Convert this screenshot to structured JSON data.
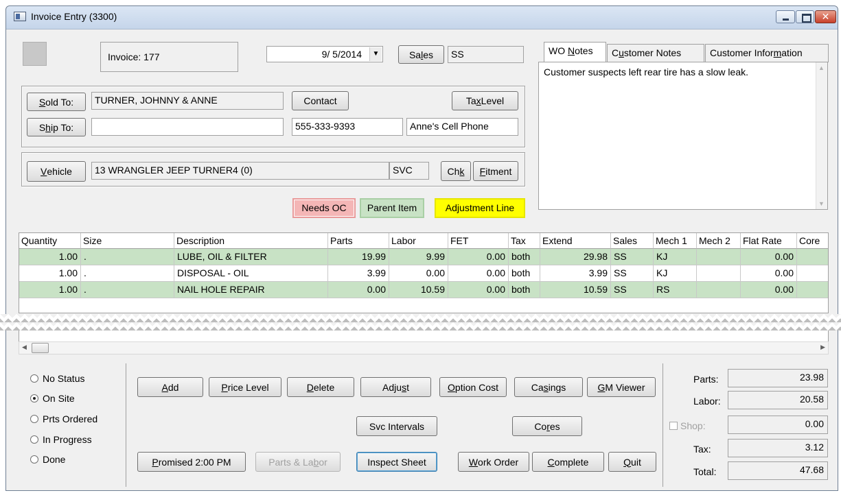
{
  "window": {
    "title": "Invoice Entry (3300)"
  },
  "header": {
    "invoice_label": "Invoice: 177",
    "date_value": "9/ 5/2014",
    "sales_button": "Sales",
    "sales_value": "SS"
  },
  "customer": {
    "sold_to_button": "Sold To:",
    "sold_to_value": "TURNER, JOHNNY & ANNE",
    "ship_to_button": "Ship To:",
    "ship_to_value": "",
    "contact_button": "Contact",
    "tax_level_button": "Tax Level",
    "phone_value": "555-333-9393",
    "phone_desc": "Anne's Cell Phone"
  },
  "vehicle": {
    "vehicle_button": "Vehicle",
    "vehicle_value": "13 WRANGLER JEEP TURNER4 (0)",
    "svc_value": "SVC",
    "chk_button": "Chk",
    "fitment_button": "Fitment"
  },
  "legend": {
    "needs_oc": "Needs OC",
    "parent_item": "Parent Item",
    "adjustment_line": "Adjustment Line",
    "colors": {
      "needs_oc": "#f4b6b6",
      "parent_item": "#c8e2c5",
      "adjustment_line": "#ffff00"
    }
  },
  "notes_tabs": {
    "tabs": [
      "WO Notes",
      "Customer Notes",
      "Customer Information"
    ],
    "active": "WO Notes",
    "text": "Customer suspects left rear tire has a slow leak."
  },
  "grid": {
    "columns": [
      "Quantity",
      "Size",
      "Description",
      "Parts",
      "Labor",
      "FET",
      "Tax",
      "Extend",
      "Sales",
      "Mech 1",
      "Mech 2",
      "Flat Rate",
      "Core"
    ],
    "rows": [
      {
        "quantity": "1.00",
        "size": ".",
        "description": "LUBE, OIL & FILTER",
        "parts": "19.99",
        "labor": "9.99",
        "fet": "0.00",
        "tax": "both",
        "extend": "29.98",
        "sales": "SS",
        "mech1": "KJ",
        "mech2": "",
        "flat_rate": "0.00",
        "core": "",
        "highlight": "green"
      },
      {
        "quantity": "1.00",
        "size": ".",
        "description": "DISPOSAL - OIL",
        "parts": "3.99",
        "labor": "0.00",
        "fet": "0.00",
        "tax": "both",
        "extend": "3.99",
        "sales": "SS",
        "mech1": "KJ",
        "mech2": "",
        "flat_rate": "0.00",
        "core": "",
        "highlight": "none"
      },
      {
        "quantity": "1.00",
        "size": ".",
        "description": "NAIL HOLE REPAIR",
        "parts": "0.00",
        "labor": "10.59",
        "fet": "0.00",
        "tax": "both",
        "extend": "10.59",
        "sales": "SS",
        "mech1": "RS",
        "mech2": "",
        "flat_rate": "0.00",
        "core": "",
        "highlight": "green"
      }
    ]
  },
  "status": {
    "options": [
      "No Status",
      "On Site",
      "Prts Ordered",
      "In Progress",
      "Done"
    ],
    "selected": "On Site"
  },
  "buttons": {
    "add": "Add",
    "price_level": "Price Level",
    "delete": "Delete",
    "adjust": "Adjust",
    "option_cost": "Option Cost",
    "casings": "Casings",
    "gm_viewer": "GM Viewer",
    "svc_intervals": "Svc Intervals",
    "cores": "Cores",
    "promised": "Promised 2:00 PM",
    "parts_labor": "Parts & Labor",
    "inspect_sheet": "Inspect Sheet",
    "work_order": "Work Order",
    "complete": "Complete",
    "quit": "Quit"
  },
  "totals": {
    "parts_label": "Parts:",
    "parts_value": "23.98",
    "labor_label": "Labor:",
    "labor_value": "20.58",
    "shop_label": "Shop:",
    "shop_value": "0.00",
    "tax_label": "Tax:",
    "tax_value": "3.12",
    "total_label": "Total:",
    "total_value": "47.68"
  }
}
